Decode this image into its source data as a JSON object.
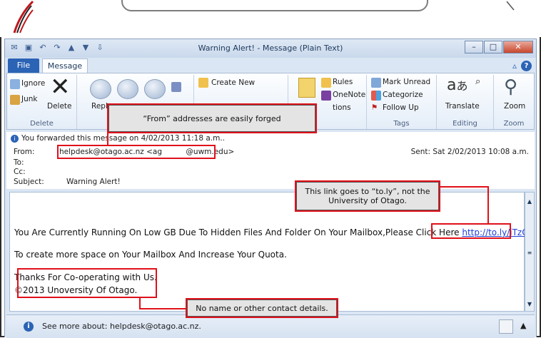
{
  "window": {
    "title": "Warning Alert! - Message (Plain Text)",
    "tabs": [
      "File",
      "Message"
    ]
  },
  "ribbon": {
    "delete_group": {
      "ignore": "Ignore",
      "junk": "Junk",
      "delete": "Delete",
      "label": "Delete"
    },
    "respond_group": {
      "reply": "Reply"
    },
    "quick_steps": {
      "create_new": "Create New"
    },
    "move_group": {
      "rules": "Rules",
      "onenote": "OneNote",
      "actions": "tions"
    },
    "tags_group": {
      "mark_unread": "Mark Unread",
      "categorize": "Categorize",
      "follow_up": "Follow Up",
      "label": "Tags"
    },
    "editing_group": {
      "translate": "Translate",
      "label": "Editing"
    },
    "zoom_group": {
      "zoom": "Zoom",
      "label": "Zoom"
    }
  },
  "header": {
    "info": "You forwarded this message on 4/02/2013 11:18 a.m..",
    "from_label": "From:",
    "from_value": "helpdesk@otago.ac.nz <ag          @uwm.edu>",
    "to_label": "To:",
    "cc_label": "Cc:",
    "subject_label": "Subject:",
    "subject_value": "Warning Alert!",
    "sent": "Sent:  Sat 2/02/2013 10:08 a.m."
  },
  "body": {
    "line1": "You Are Currently Running On Low GB Due To Hidden Files And Folder On Your Mailbox,Please Click Here",
    "link": "http://to.ly/iTzQ",
    "line2": "To create more space on Your Mailbox And Increase Your Quota.",
    "line3": "Thanks For Co-operating with Us.",
    "line4": "©2013 Unoversity Of Otago."
  },
  "footer": {
    "text": "See more about: helpdesk@otago.ac.nz."
  },
  "callouts": {
    "from_note": "“From” addresses are easily forged",
    "link_note_1": "This link goes to “to.ly”, not the",
    "link_note_2": "University of Otago.",
    "contact_note": "No name or other contact details."
  },
  "colors": {
    "annotation_red": "#e0101a",
    "file_tab": "#2b63b5",
    "link": "#1f3fd6"
  }
}
